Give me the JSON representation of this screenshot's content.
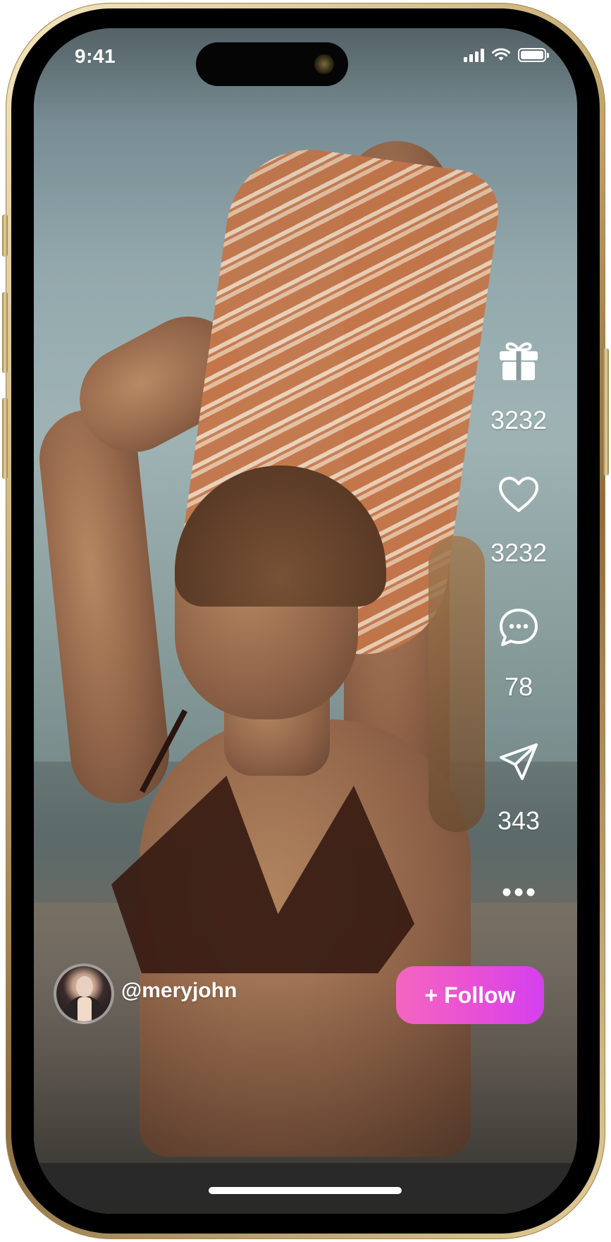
{
  "status_bar": {
    "time": "9:41"
  },
  "actions": [
    {
      "icon": "gift-icon",
      "count": "3232"
    },
    {
      "icon": "heart-icon",
      "count": "3232"
    },
    {
      "icon": "comment-icon",
      "count": "78"
    },
    {
      "icon": "send-icon",
      "count": "343"
    }
  ],
  "more_icon": "more-horizontal-icon",
  "user": {
    "handle": "@meryjohn"
  },
  "follow_label": "+ Follow",
  "colors": {
    "follow_gradient_start": "#f466c0",
    "follow_gradient_end": "#d43ff0",
    "frame_gold": "#c8ad74"
  }
}
